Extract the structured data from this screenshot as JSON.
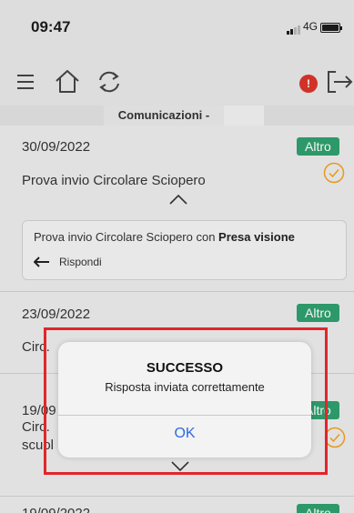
{
  "status_bar": {
    "time": "09:47",
    "network": "4G"
  },
  "toolbar": {
    "menu_icon": "hamburger-menu-icon",
    "home_icon": "home-icon",
    "refresh_icon": "refresh-icon",
    "notification_count": "!",
    "logout_icon": "logout-icon"
  },
  "section": {
    "title": "Comunicazioni -"
  },
  "items": [
    {
      "date": "30/09/2022",
      "badge": "Altro",
      "subject": "Prova invio Circolare Sciopero",
      "detail_text": "Prova invio Circolare Sciopero con ",
      "detail_bold": "Presa visione",
      "reply_label": "Rispondi"
    },
    {
      "date": "23/09/2022",
      "badge": "Altro",
      "subject": "Circ. "
    },
    {
      "date": "19/09",
      "badge": "Altro",
      "subject": "Circ.",
      "subject_line2": "scuol"
    },
    {
      "date": "19/09/2022",
      "badge": "Altro"
    }
  ],
  "dialog": {
    "title": "SUCCESSO",
    "message": "Risposta inviata correttamente",
    "ok_label": "OK"
  },
  "colors": {
    "badge_green": "#2f9f6e",
    "notification_red": "#d9352a",
    "highlight_red": "#e0262b",
    "link_blue": "#2d6be0",
    "check_orange": "#f0a020"
  }
}
